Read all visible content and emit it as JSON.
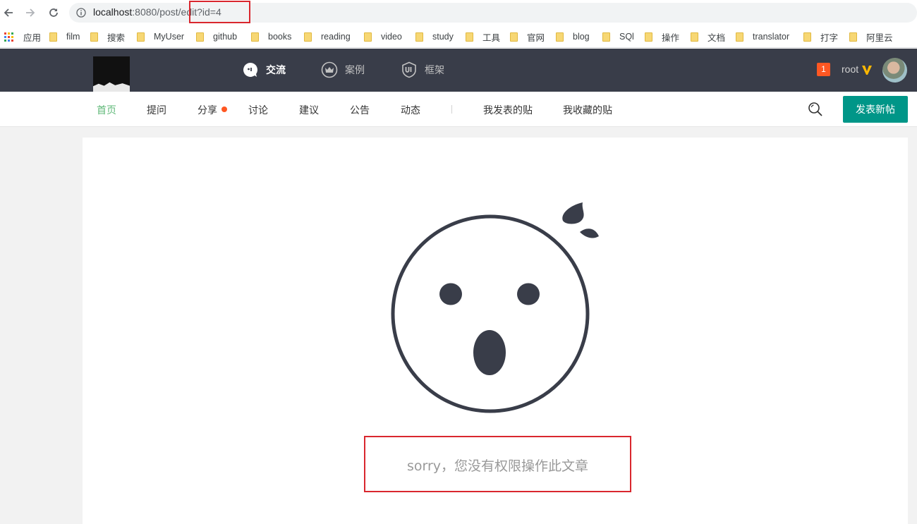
{
  "browser": {
    "url_host": "localhost",
    "url_rest": ":8080/post/edit?id=4",
    "bookmarks": [
      {
        "label": "应用",
        "type": "apps"
      },
      {
        "label": "film"
      },
      {
        "label": "搜索"
      },
      {
        "label": "MyUser"
      },
      {
        "label": "github"
      },
      {
        "label": "books"
      },
      {
        "label": "reading"
      },
      {
        "label": "video"
      },
      {
        "label": "study"
      },
      {
        "label": "工具"
      },
      {
        "label": "官网"
      },
      {
        "label": "blog"
      },
      {
        "label": "SQl"
      },
      {
        "label": "操作"
      },
      {
        "label": "文档"
      },
      {
        "label": "translator"
      },
      {
        "label": "打字"
      },
      {
        "label": "阿里云"
      }
    ]
  },
  "header": {
    "nav": [
      {
        "label": "交流",
        "icon": "chat-bubble-icon",
        "active": true
      },
      {
        "label": "案例",
        "icon": "crown-icon",
        "active": false
      },
      {
        "label": "框架",
        "icon": "ui-shield-icon",
        "active": false
      }
    ],
    "notification_count": "1",
    "username": "root"
  },
  "subnav": {
    "items": [
      "首页",
      "提问",
      "分享",
      "讨论",
      "建议",
      "公告",
      "动态"
    ],
    "my_posts": "我发表的贴",
    "my_favorites": "我收藏的贴",
    "new_post_button": "发表新帖"
  },
  "content": {
    "message": "sorry，您没有权限操作此文章"
  },
  "colors": {
    "header_bg": "#393d49",
    "accent_green": "#009688",
    "active_link": "#5fb878",
    "badge": "#ff5722",
    "highlight_box": "#d9272e",
    "face": "#393d49"
  }
}
